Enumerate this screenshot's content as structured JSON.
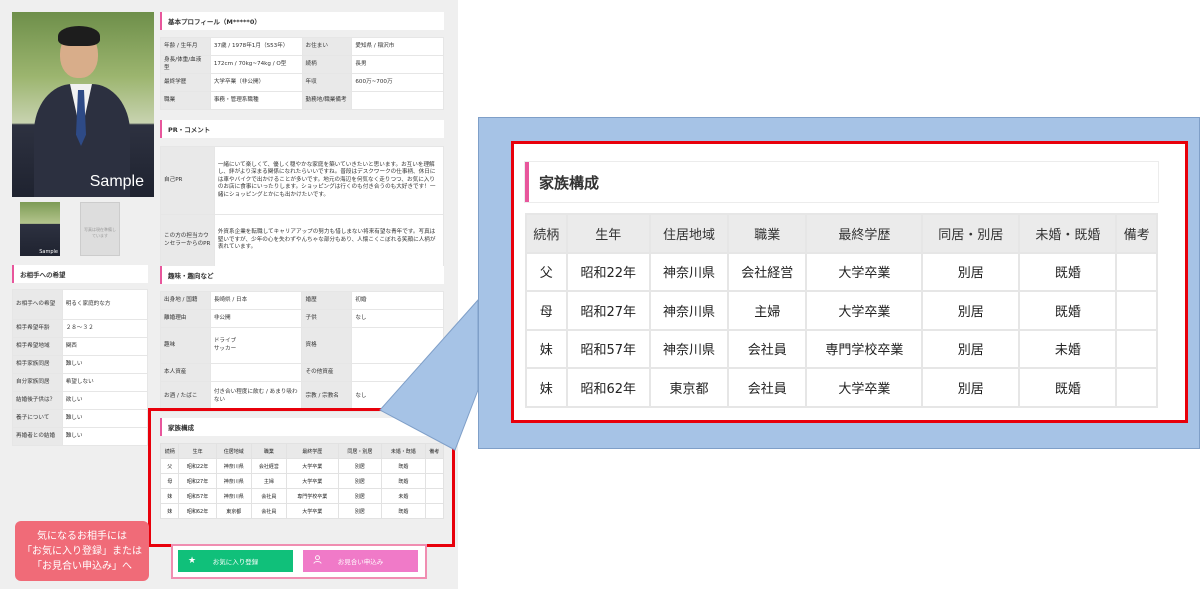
{
  "photo": {
    "sample_label": "Sample",
    "thumb_sample_label": "Sample",
    "thumb2_label": "写真は現在準備しています"
  },
  "basic_profile": {
    "title": "基本プロフィール（M*****0）",
    "rows": [
      [
        "年齢 / 生年月",
        "37歳 / 1978年1月（S53年）",
        "お住まい",
        "愛知県 / 稲沢市"
      ],
      [
        "身長/体重/血液型",
        "172cm / 70kg~74kg / O型",
        "続柄",
        "長男"
      ],
      [
        "最終学歴",
        "大学卒業（非公開）",
        "年収",
        "600万~700万"
      ],
      [
        "職業",
        "事務・管理系職種",
        "勤務地/職業備考",
        ""
      ]
    ]
  },
  "pr": {
    "title": "PR・コメント",
    "rows": [
      [
        "自己PR",
        "一緒にいて楽しくて、優しく穏やかな家庭を築いていきたいと思います。お互いを理解し、絆がより深まる関係になれたらいいですね。普段はデスクワークの仕事柄、休日には車やバイクで出かけることが多いです。地元の海辺を何気なく走りつつ、お気に入りのお店に食事にいったりします。ショッピングは行くのも付き合うのも大好きです！一緒にショッピングとかにも出かけたいです。"
      ],
      [
        "この方の担当カウンセラーからのPR",
        "外資系企業を転職してキャリアアップの努力も惜しまない将来有望な青年です。写真は堅いですが、少年の心を失わずやんちゃな部分もあり、人懐こくこぼれる笑顔に人柄が表れています。"
      ]
    ]
  },
  "partner_wish": {
    "title": "お相手への希望",
    "rows": [
      [
        "お相手への希望",
        "明るく家庭的な方"
      ],
      [
        "相手希望年齢",
        "２８～３２"
      ],
      [
        "相手希望地域",
        "関西"
      ],
      [
        "相手家族同居",
        "難しい"
      ],
      [
        "自分家族同居",
        "希望しない"
      ],
      [
        "結婚後子供は？",
        "欲しい"
      ],
      [
        "養子について",
        "難しい"
      ],
      [
        "再婚者との結婚",
        "難しい"
      ]
    ]
  },
  "hobby": {
    "title": "趣味・趣向など",
    "rows": [
      [
        "出身地 / 国籍",
        "長崎県 / 日本",
        "婚歴",
        "初婚"
      ],
      [
        "離婚理由",
        "非公開",
        "子供",
        "なし"
      ],
      [
        "趣味",
        "ドライブ\nサッカー",
        "資格",
        ""
      ],
      [
        "本人資産",
        "",
        "その他資産",
        ""
      ],
      [
        "お酒 / たばこ",
        "付き合い程度に飲む / あまり吸わない",
        "宗教 / 宗教名",
        "なし"
      ]
    ]
  },
  "family": {
    "title": "家族構成",
    "headers": [
      "続柄",
      "生年",
      "住居地域",
      "職業",
      "最終学歴",
      "同居・別居",
      "未婚・既婚",
      "備考"
    ],
    "rows": [
      [
        "父",
        "昭和22年",
        "神奈川県",
        "会社経営",
        "大学卒業",
        "別居",
        "既婚",
        ""
      ],
      [
        "母",
        "昭和27年",
        "神奈川県",
        "主婦",
        "大学卒業",
        "別居",
        "既婚",
        ""
      ],
      [
        "妹",
        "昭和57年",
        "神奈川県",
        "会社員",
        "専門学校卒業",
        "別居",
        "未婚",
        ""
      ],
      [
        "妹",
        "昭和62年",
        "東京都",
        "会社員",
        "大学卒業",
        "別居",
        "既婚",
        ""
      ]
    ]
  },
  "buttons": {
    "favorite": "お気に入り登録",
    "apply": "お見合い申込み"
  },
  "callout": {
    "lines": [
      "気になるお相手には",
      "「お気に入り登録」または",
      "「お見合い申込み」へ"
    ]
  },
  "colors": {
    "accent_pink": "#e8569c",
    "highlight_red": "#e8000b",
    "favorite_green": "#10c07a",
    "apply_pink": "#f07ac8",
    "callout_red": "#f06b78",
    "zoom_blue": "#a6c3e6"
  }
}
